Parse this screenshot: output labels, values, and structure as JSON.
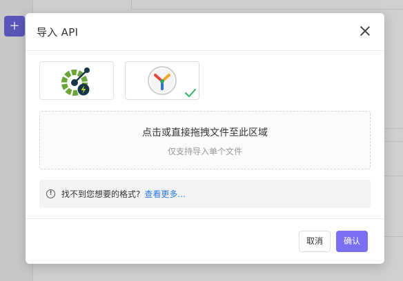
{
  "dialog": {
    "title": "导入 API",
    "close_icon": "close-icon"
  },
  "formats": [
    {
      "name": "openapi",
      "icon": "openapi-icon",
      "selected": false
    },
    {
      "name": "yapi",
      "icon": "yapi-icon",
      "selected": true
    }
  ],
  "dropzone": {
    "main_text": "点击或直接拖拽文件至此区域",
    "sub_text": "仅支持导入单个文件"
  },
  "notice": {
    "icon": "info-icon",
    "text": "找不到您想要的格式?",
    "link_text": "查看更多..."
  },
  "footer": {
    "cancel_label": "取消",
    "ok_label": "确认"
  },
  "background": {
    "add_label": "+"
  },
  "colors": {
    "primary": "#7a6ff0",
    "link": "#2a7ae2",
    "check": "#2db55d",
    "openapi_green": "#6ba539",
    "openapi_dark": "#173647"
  }
}
